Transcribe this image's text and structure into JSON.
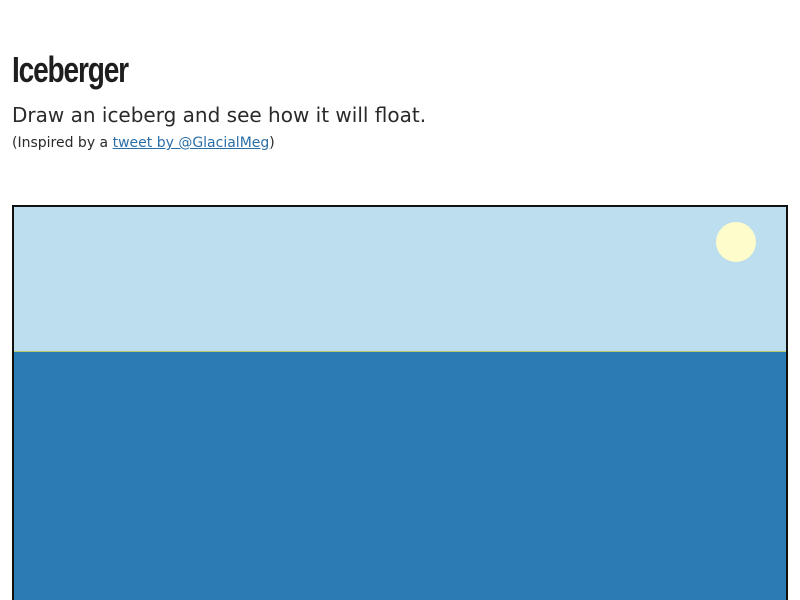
{
  "header": {
    "title": "Iceberger",
    "subtitle": "Draw an iceberg and see how it will float.",
    "credit": {
      "prefix": "(Inspired by a ",
      "link_text": "tweet by @GlacialMeg",
      "suffix": ")"
    }
  },
  "canvas": {
    "sky_color": "#bcdeee",
    "water_color": "#2d7bb5",
    "sun_color": "#fffccc",
    "waterline_color": "#b9c96a",
    "border_color": "#111111"
  }
}
